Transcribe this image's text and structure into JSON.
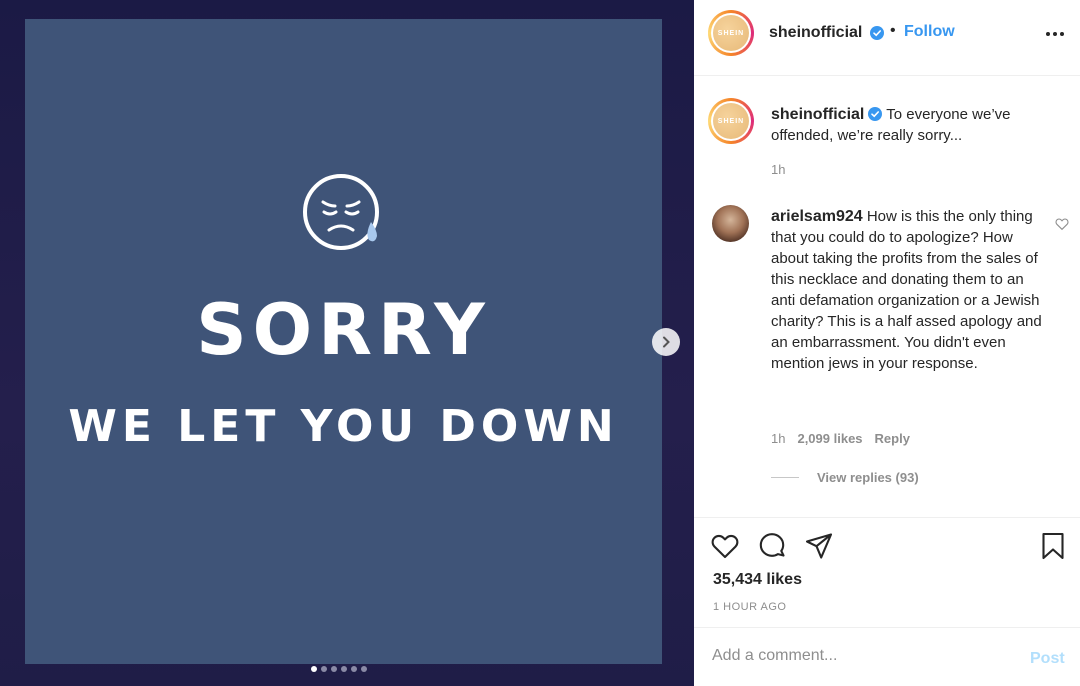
{
  "media": {
    "headline": "SORRY",
    "subline": "WE LET YOU DOWN",
    "slide_count": 6,
    "active_slide": 1,
    "background_color": "#3f5478"
  },
  "header": {
    "username": "sheinofficial",
    "avatar_text": "SHEIN",
    "bullet": "•",
    "follow_label": "Follow",
    "more_icon": "more-options-icon"
  },
  "caption": {
    "username": "sheinofficial",
    "text": "To everyone we’ve offended, we’re really sorry...",
    "time": "1h"
  },
  "comment": {
    "username": "arielsam924",
    "text": "How is this the only thing that you could do to apologize? How about taking the profits from the sales of this necklace and donating them to an anti defamation organization or a Jewish charity? This is a half assed apology and an embarrassment. You didn't even mention jews in your response.",
    "time": "1h",
    "likes": "2,099 likes",
    "reply_label": "Reply",
    "view_replies": "View replies (93)"
  },
  "post": {
    "likes": "35,434 likes",
    "posted_ago": "1 HOUR AGO"
  },
  "add_comment": {
    "placeholder": "Add a comment...",
    "post_label": "Post"
  },
  "colors": {
    "accent": "#3897f0",
    "post_disabled": "#b2dffc",
    "media_bg": "#1b1a45"
  }
}
